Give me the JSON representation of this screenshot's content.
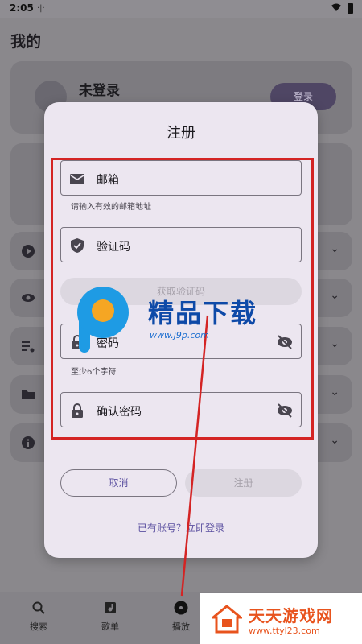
{
  "status_bar": {
    "time": "2:05",
    "signal": "·|·"
  },
  "app": {
    "title": "我的"
  },
  "user_card": {
    "name": "未登录",
    "login_label": "登录"
  },
  "bottom_nav": [
    {
      "label": "搜索",
      "icon": "search-icon"
    },
    {
      "label": "歌单",
      "icon": "playlist-icon"
    },
    {
      "label": "播放",
      "icon": "player-icon"
    }
  ],
  "dialog": {
    "title": "注册",
    "email": {
      "label": "邮箱",
      "helper": "请输入有效的邮箱地址"
    },
    "code": {
      "label": "验证码"
    },
    "get_code_label": "获取验证码",
    "password": {
      "label": "密码",
      "helper": "至少6个字符"
    },
    "confirm_password": {
      "label": "确认密码"
    },
    "cancel_label": "取消",
    "register_label": "注册",
    "login_link": "已有账号？立即登录"
  },
  "watermark": {
    "title": "精品下载",
    "url": "www.j9p.com"
  },
  "corner_logo": {
    "title": "天天游戏网",
    "url": "www.ttyl23.com"
  },
  "colors": {
    "accent": "#5b50a0",
    "annotation": "#d42424",
    "dialog_bg": "#ece6f0"
  }
}
